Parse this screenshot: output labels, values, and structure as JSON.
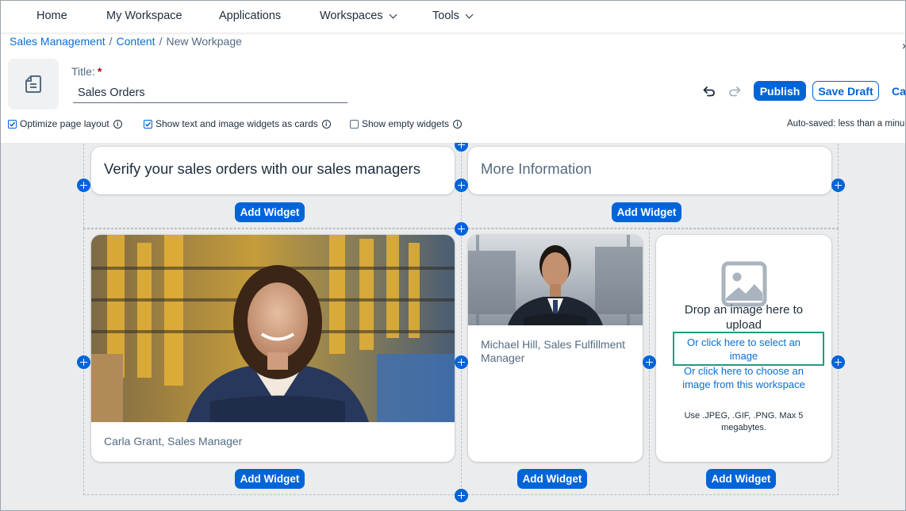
{
  "nav": {
    "items": [
      {
        "label": "Home"
      },
      {
        "label": "My Workspace"
      },
      {
        "label": "Applications"
      },
      {
        "label": "Workspaces",
        "has_dropdown": true
      },
      {
        "label": "Tools",
        "has_dropdown": true
      }
    ]
  },
  "breadcrumb": {
    "items": [
      "Sales Management",
      "Content"
    ],
    "current": "New Workpage",
    "separator": "/"
  },
  "header": {
    "page_icon": "document-icon",
    "title_label": "Title:",
    "required_mark": "*",
    "title_value": "Sales Orders",
    "publish_label": "Publish",
    "save_draft_label": "Save Draft",
    "cancel_label": "Ca",
    "close_glyph": "×",
    "options": {
      "optimize_layout": {
        "label": "Optimize page layout",
        "checked": true
      },
      "show_cards": {
        "label": "Show text and image widgets as cards",
        "checked": true
      },
      "show_empty": {
        "label": "Show empty widgets",
        "checked": false
      }
    },
    "autosaved_text": "Auto-saved: less than a minu"
  },
  "section1": {
    "card1_heading": "Verify your sales orders with our sales managers",
    "card2_heading": "More Information",
    "add_widget_label": "Add Widget"
  },
  "section2": {
    "card1_caption": "Carla Grant, Sales Manager",
    "card2_caption": "Michael Hill, Sales Fulfillment Manager",
    "upload": {
      "drop_text": "Drop an image here to upload",
      "select_link": "Or click here to select an image",
      "workspace_link": "Or click here to choose an image from this workspace",
      "hint": "Use .JPEG, .GIF, .PNG. Max 5 megabytes."
    },
    "add_widget_label": "Add Widget"
  },
  "colors": {
    "accent": "#0064d9",
    "link": "#0a6ed1",
    "highlight": "#1f9c82",
    "canvas_bg": "#eaecee"
  }
}
